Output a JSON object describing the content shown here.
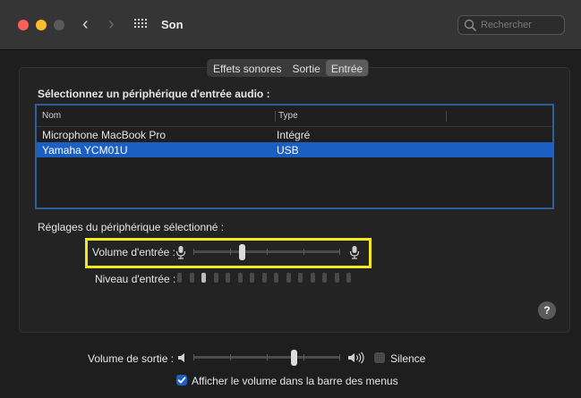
{
  "window": {
    "title": "Son"
  },
  "search": {
    "placeholder": "Rechercher"
  },
  "tabs": [
    "Effets sonores",
    "Sortie",
    "Entrée"
  ],
  "active_tab": "Entrée",
  "device_section": {
    "heading": "Sélectionnez un périphérique d'entrée audio :",
    "columns": [
      "Nom",
      "Type"
    ],
    "rows": [
      {
        "name": "Microphone MacBook Pro",
        "type": "Intégré",
        "selected": false
      },
      {
        "name": "Yamaha YCM01U",
        "type": "USB",
        "selected": true
      }
    ]
  },
  "settings": {
    "heading": "Réglages du périphérique sélectionné :",
    "input_volume_label": "Volume d'entrée :",
    "input_volume_level": 0.33,
    "input_level_label": "Niveau d'entrée :",
    "input_level_lit_segments": 1,
    "input_level_total_segments": 15
  },
  "output": {
    "volume_label": "Volume de sortie :",
    "volume_level": 0.68,
    "mute_label": "Silence",
    "mute_checked": false,
    "menubar_label": "Afficher le volume dans la barre des menus",
    "menubar_checked": true
  },
  "colors": {
    "accent": "#1c5fc2",
    "highlight": "#f2ea1b",
    "close": "#fe5f57",
    "minimize": "#febc2e",
    "zoom": "#5a5a5a"
  },
  "icons": [
    "back-chevron-icon",
    "forward-chevron-icon",
    "grid-icon",
    "search-icon",
    "microphone-icon",
    "speaker-low-icon",
    "speaker-high-icon",
    "help-icon",
    "checkmark-icon"
  ]
}
